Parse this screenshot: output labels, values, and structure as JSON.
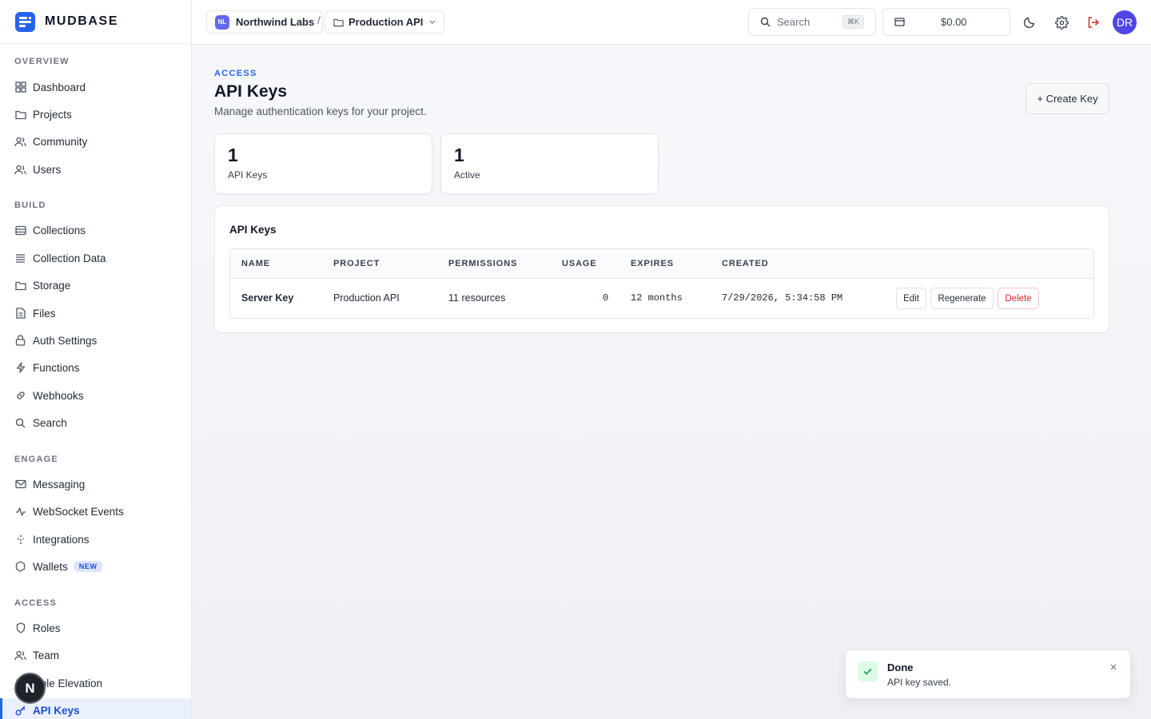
{
  "app": {
    "name": "MUDBASE"
  },
  "sidebar": {
    "sections": [
      {
        "label": "OVERVIEW"
      },
      {
        "label": "BUILD"
      },
      {
        "label": "ENGAGE"
      },
      {
        "label": "ACCESS"
      }
    ],
    "items": [
      {
        "label": "Dashboard",
        "icon": "grid-icon"
      },
      {
        "label": "Projects",
        "icon": "folder-icon"
      },
      {
        "label": "Community",
        "icon": "users-icon"
      },
      {
        "label": "Users",
        "icon": "users-icon"
      },
      {
        "label": "Collections",
        "icon": "database-icon"
      },
      {
        "label": "Collection Data",
        "icon": "list-icon"
      },
      {
        "label": "Storage",
        "icon": "folder-icon"
      },
      {
        "label": "Files",
        "icon": "file-icon"
      },
      {
        "label": "Auth Settings",
        "icon": "lock-icon"
      },
      {
        "label": "Functions",
        "icon": "bolt-icon"
      },
      {
        "label": "Webhooks",
        "icon": "link-icon"
      },
      {
        "label": "Search",
        "icon": "search-icon"
      },
      {
        "label": "Messaging",
        "icon": "mail-icon"
      },
      {
        "label": "WebSocket Events",
        "icon": "activity-icon"
      },
      {
        "label": "Integrations",
        "icon": "sparkle-icon"
      },
      {
        "label": "Wallets",
        "icon": "hexagon-icon",
        "badge": "NEW"
      },
      {
        "label": "Roles",
        "icon": "shield-icon"
      },
      {
        "label": "Team",
        "icon": "users-icon"
      },
      {
        "label": "Role Elevation",
        "icon": "shield-icon"
      },
      {
        "label": "API Keys",
        "icon": "key-icon",
        "active": true
      }
    ],
    "floating_badge": "N"
  },
  "topbar": {
    "org": {
      "initials": "NL",
      "name": "Northwind Labs"
    },
    "separator": "/",
    "project": {
      "name": "Production API"
    },
    "search": {
      "placeholder": "Search",
      "shortcut": "⌘K"
    },
    "balance": "$0.00",
    "avatar": "DR"
  },
  "page": {
    "eyebrow": "ACCESS",
    "title": "API Keys",
    "subtitle": "Manage authentication keys for your project.",
    "create_button": "+ Create Key",
    "stats": [
      {
        "value": "1",
        "label": "API Keys"
      },
      {
        "value": "1",
        "label": "Active"
      }
    ]
  },
  "table": {
    "title": "API Keys",
    "columns": [
      "NAME",
      "PROJECT",
      "PERMISSIONS",
      "USAGE",
      "EXPIRES",
      "CREATED"
    ],
    "rows": [
      {
        "name": "Server Key",
        "project": "Production API",
        "permissions": "11 resources",
        "usage": "0",
        "expires": "12 months",
        "created": "7/29/2026, 5:34:58 PM",
        "actions": {
          "edit": "Edit",
          "regenerate": "Regenerate",
          "delete": "Delete"
        }
      }
    ]
  },
  "toast": {
    "title": "Done",
    "message": "API key saved.",
    "status_color": "#16a34a"
  },
  "colors": {
    "accent": "#2563eb",
    "danger": "#dc2626",
    "success": "#16a34a"
  }
}
